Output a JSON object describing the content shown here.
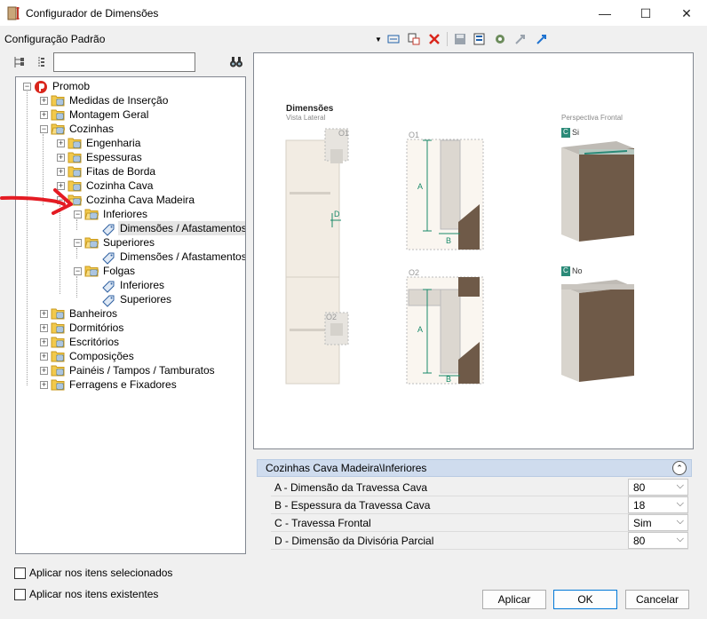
{
  "window": {
    "title": "Configurador de Dimensões",
    "minimize": "—",
    "maximize": "☐",
    "close": "✕"
  },
  "toolbar": {
    "config_label": "Configuração Padrão",
    "dropdown_icon": "chevron-down",
    "buttons": [
      "insert-dimension-icon",
      "copy-icon",
      "delete-icon",
      "save-icon",
      "properties-icon",
      "settings-icon",
      "arrow-up-icon",
      "arrow-down-icon"
    ]
  },
  "tree": {
    "search_value": "",
    "nodes": [
      {
        "label": "Promob"
      },
      {
        "label": "Medidas de Inserção"
      },
      {
        "label": "Montagem Geral"
      },
      {
        "label": "Cozinhas"
      },
      {
        "label": "Engenharia"
      },
      {
        "label": "Espessuras"
      },
      {
        "label": "Fitas de Borda"
      },
      {
        "label": "Cozinha Cava"
      },
      {
        "label": "Cozinha Cava Madeira"
      },
      {
        "label": "Inferiores"
      },
      {
        "label": "Dimensões / Afastamentos"
      },
      {
        "label": "Superiores"
      },
      {
        "label": "Dimensões / Afastamentos"
      },
      {
        "label": "Folgas"
      },
      {
        "label": "Inferiores"
      },
      {
        "label": "Superiores"
      },
      {
        "label": "Banheiros"
      },
      {
        "label": "Dormitórios"
      },
      {
        "label": "Escritórios"
      },
      {
        "label": "Composições"
      },
      {
        "label": "Painéis / Tampos / Tamburatos"
      },
      {
        "label": "Ferragens e Fixadores"
      }
    ]
  },
  "preview": {
    "heading": "Dimensões",
    "subheading": "Vista Lateral",
    "perspective": "Perspectiva Frontal",
    "o1": "O1",
    "o2": "O2",
    "a": "A",
    "b": "B",
    "d": "D",
    "c": "C",
    "si": "Si",
    "no": "No",
    "colors": {
      "wood": "#6f5a48",
      "carcass": "#d8d4cd",
      "panel": "#efe9e0",
      "teal": "#2b8a78"
    }
  },
  "properties": {
    "section": "Cozinhas Cava Madeira\\Inferiores",
    "rows": [
      {
        "label": "A - Dimensão da Travessa Cava",
        "value": "80"
      },
      {
        "label": "B - Espessura da Travessa Cava",
        "value": "18"
      },
      {
        "label": "C - Travessa Frontal",
        "value": "Sim"
      },
      {
        "label": "D - Dimensão da Divisória Parcial",
        "value": "80"
      }
    ]
  },
  "options": {
    "apply_selected": "Aplicar nos itens selecionados",
    "apply_existing": "Aplicar nos itens existentes"
  },
  "buttons": {
    "apply": "Aplicar",
    "ok": "OK",
    "cancel": "Cancelar"
  }
}
